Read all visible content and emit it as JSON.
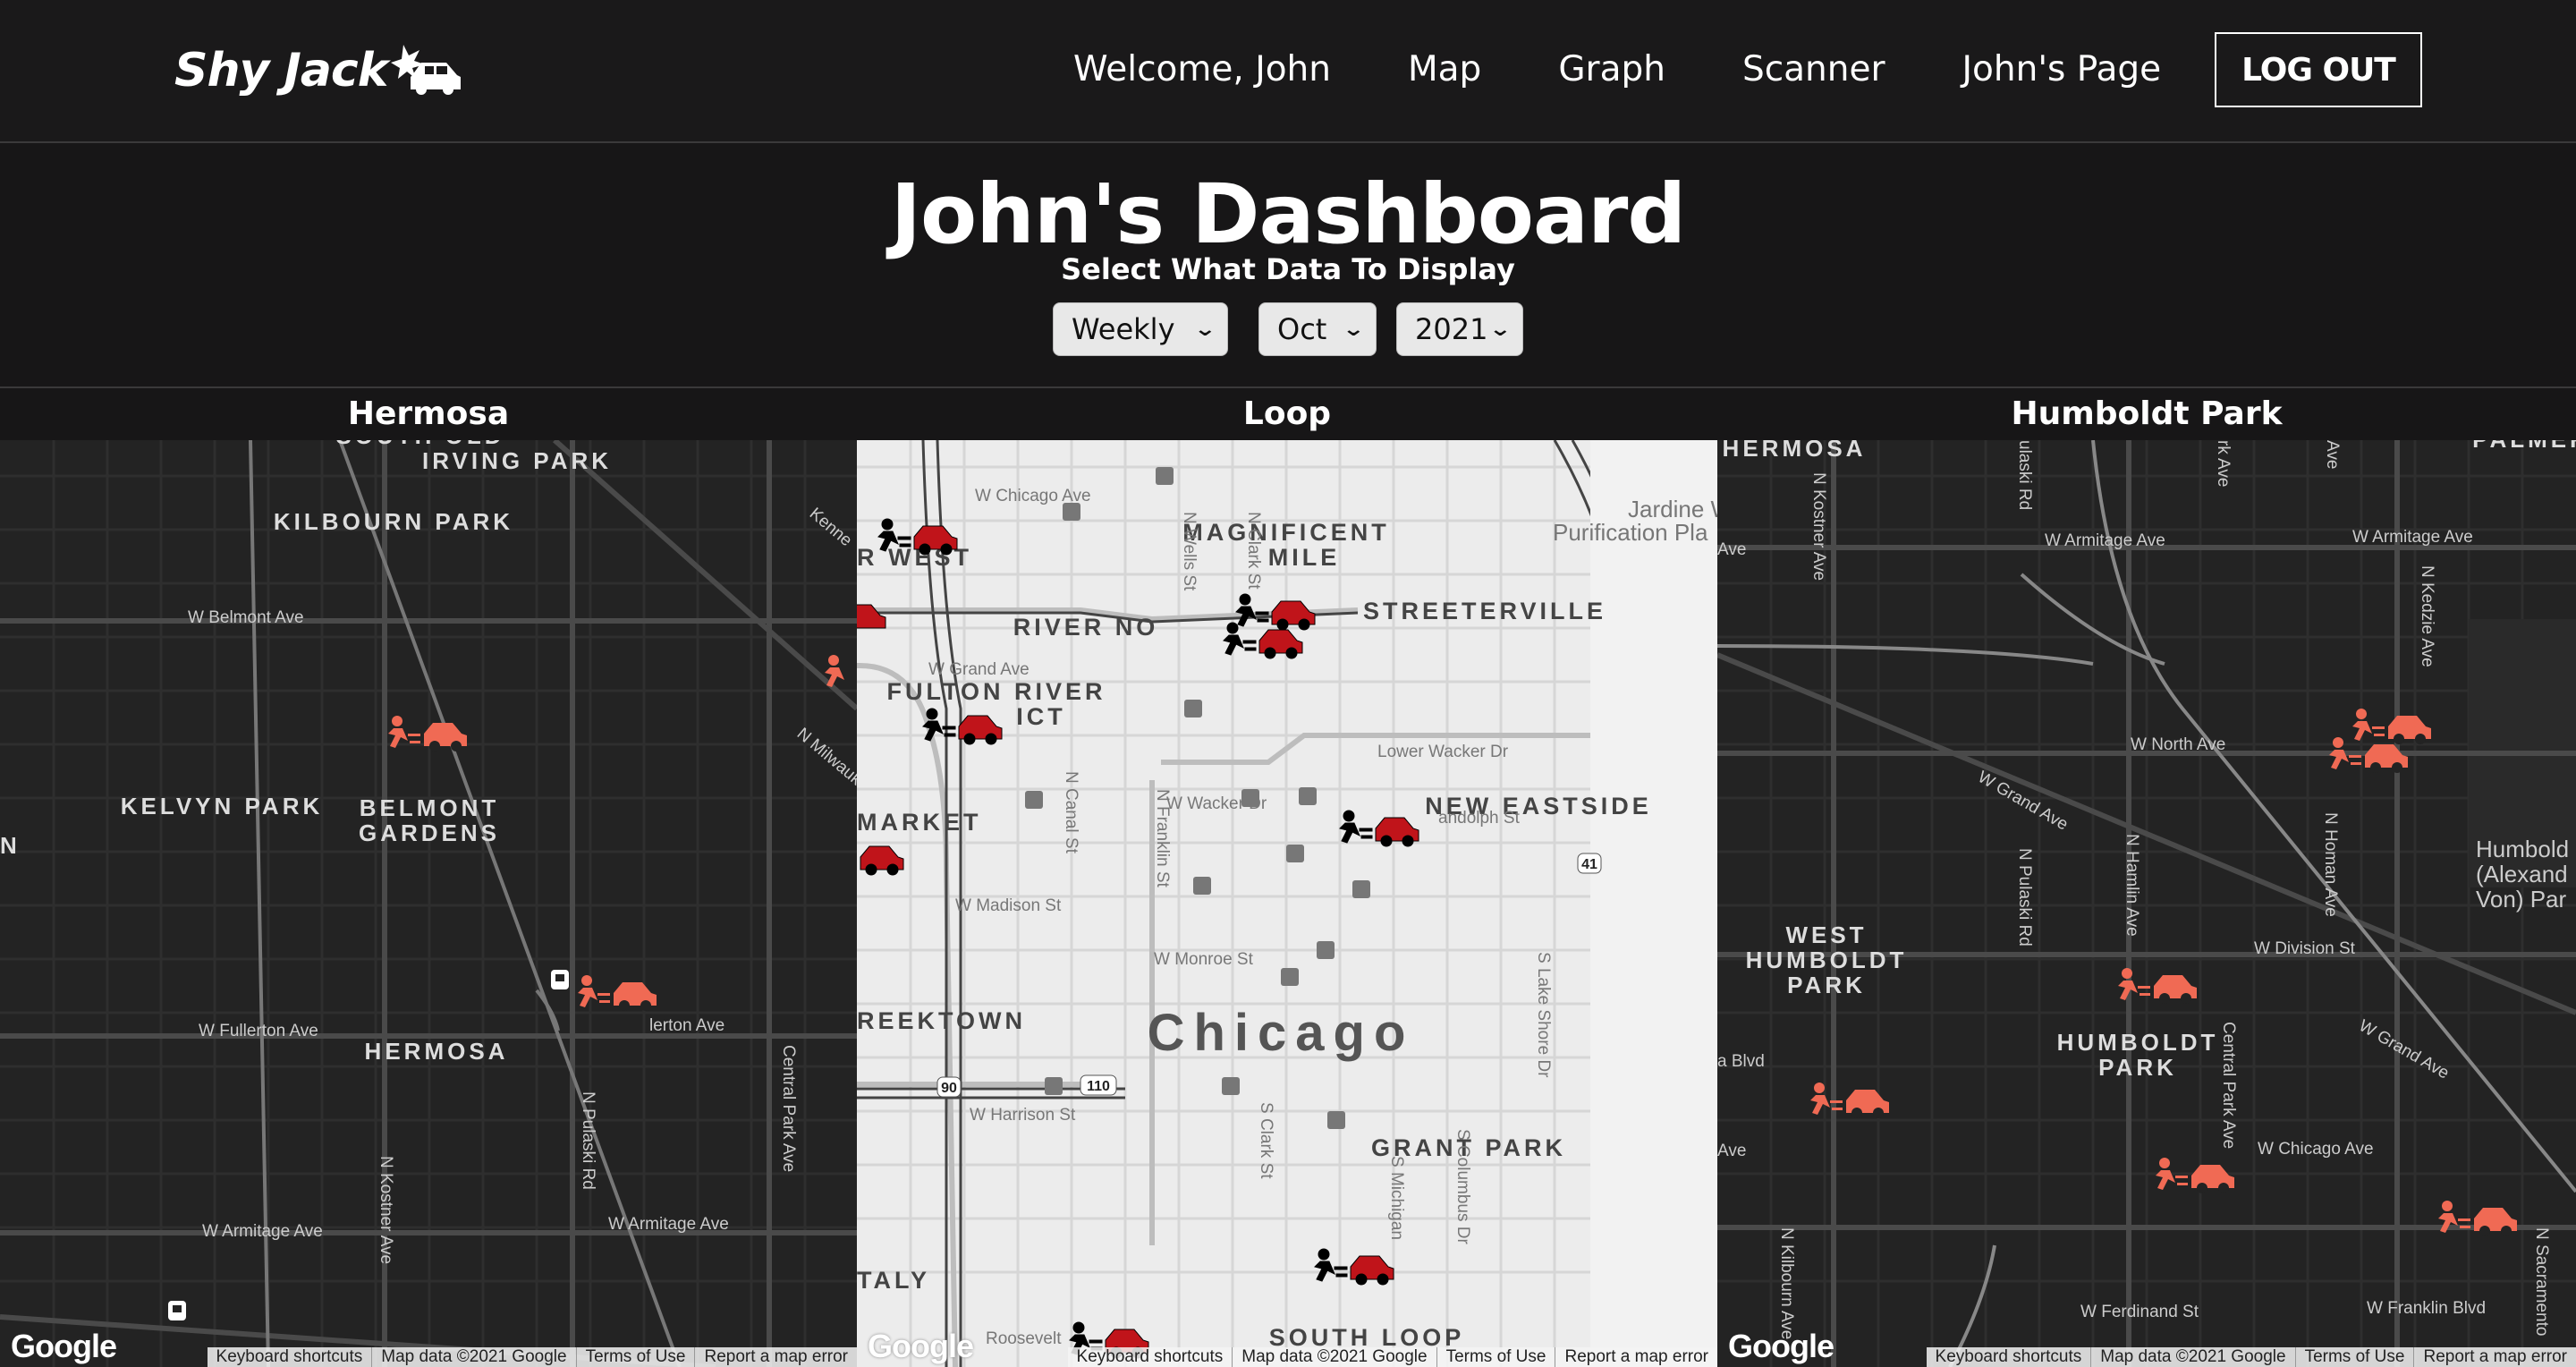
{
  "brand": {
    "name": "Shy Jack",
    "logo_icon": "crashed-car-icon"
  },
  "nav": {
    "welcome": "Welcome, John",
    "items": [
      "Map",
      "Graph",
      "Scanner",
      "John's Page"
    ],
    "logout": "LOG OUT"
  },
  "dashboard": {
    "title": "John's Dashboard",
    "subtitle": "Select What Data To Display",
    "period": "Weekly",
    "month": "Oct",
    "year": "2021"
  },
  "maps": [
    {
      "title": "Hermosa",
      "theme": "dark",
      "areas": [
        "SOUTH OLD",
        "IRVING PARK",
        "KILBOURN PARK",
        "KELVYN PARK",
        "BELMONT",
        "GARDENS",
        "HERMOSA",
        "N"
      ],
      "streets": [
        "W Belmont Ave",
        "W Fullerton Ave",
        "W Armitage Ave",
        "W Armitage Ave",
        "N Kostner Ave",
        "N Pulaski Rd",
        "Central Park Ave",
        "N Milwaukee",
        "Kenne",
        "lerton Ave"
      ]
    },
    {
      "title": "Loop",
      "theme": "light",
      "areas": [
        "MAGNIFICENT",
        "MILE",
        "STREETERVILLE",
        "RIVER NO",
        "FULTON RIVER",
        "ICT",
        "NEW EASTSIDE",
        "MARKET",
        "REEKTOWN",
        "Chicago",
        "GRANT PARK",
        "TALY",
        "SOUTH LOOP",
        "R WEST"
      ],
      "streets": [
        "W Chicago Ave",
        "W Grand Ave",
        "W Wacker Dr",
        "W Madison St",
        "W Monroe St",
        "W Harrison St",
        "Jardine Wa",
        "Purification Pla",
        "N Canal St",
        "N Franklin St",
        "N Wells St",
        "N Clark St",
        "S Clark St",
        "S Michigan",
        "S Columbus Dr",
        "S Lake Shore Dr",
        "Roosevelt",
        "Lower Wacker Dr",
        "andolph St",
        "41",
        "90",
        "110"
      ]
    },
    {
      "title": "Humboldt Park",
      "theme": "dark",
      "areas": [
        "HERMOSA",
        "PALMER",
        "WEST",
        "HUMBOLDT",
        "PARK",
        "HUMBOLDT",
        "PARK"
      ],
      "streets": [
        "W Armitage Ave",
        "W Armitage Ave",
        "W North Ave",
        "W Grand Ave",
        "W Division St",
        "W Grand Ave",
        "W Chicago Ave",
        "W Ferdinand St",
        "W Franklin Blvd",
        "N Kostner Ave",
        "N Pulaski Rd",
        "N Hamlin Ave",
        "N Homan Ave",
        "N Kedzie Ave",
        "Central Park Ave",
        "N Sacramento",
        "N Kilbourn Ave",
        "Humbold",
        "(Alexand",
        "Von) Par",
        "a Blvd",
        "Ave",
        "Ave",
        "ulaski Rd",
        "rk Ave",
        "Ave"
      ]
    }
  ],
  "map_footer": {
    "google": "Google",
    "shortcuts": "Keyboard shortcuts",
    "mapdata": "Map data ©2021 Google",
    "terms": "Terms of Use",
    "report": "Report a map error"
  },
  "colors": {
    "bg": "#171617",
    "incident_dark": "#f06a54",
    "incident_light": "#c0141a"
  }
}
